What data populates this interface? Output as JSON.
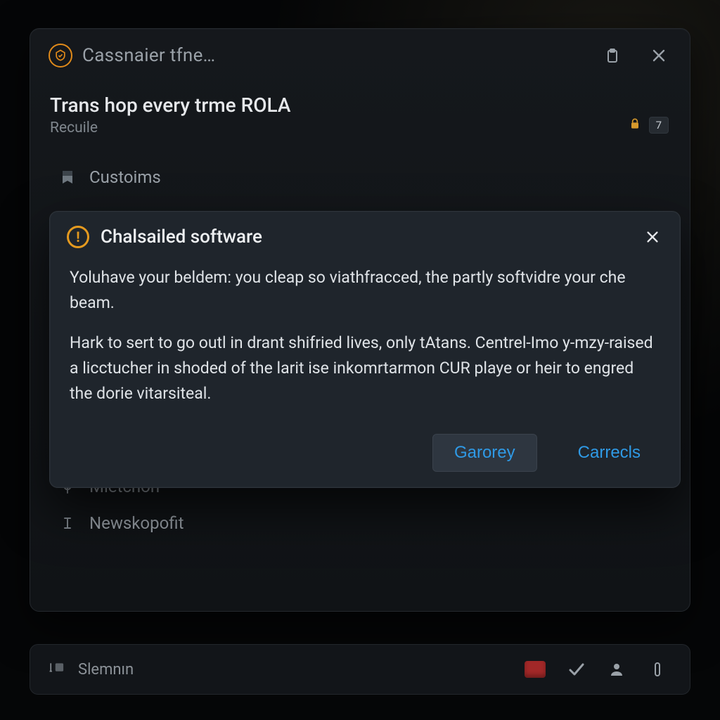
{
  "header": {
    "app_title": "Cassnaier tfne…"
  },
  "page": {
    "title": "Trans hop every trme ROLA",
    "subtitle": "Recuile",
    "badge_count": "7"
  },
  "menu": {
    "items": [
      {
        "label": "Custoims"
      },
      {
        "label": "Mietchon"
      },
      {
        "label": "Newskopofit"
      }
    ]
  },
  "dialog": {
    "title": "Chalsailed software",
    "para1": "Yoluhave your beldem: you cleap so viathfracced, the partly softvidre your che beam.",
    "para2": "Hark to sert to go outl in drant shifried lives, only tAtans. Centrel-Imo y-mzy-raised a licctucher in shoded of the larit ise inkomrtarmon CUR playe or heir to engred the dorie vitarsiteal.",
    "primary_label": "Garorey",
    "secondary_label": "Carrecls"
  },
  "bottombar": {
    "label": "Slemnın"
  }
}
